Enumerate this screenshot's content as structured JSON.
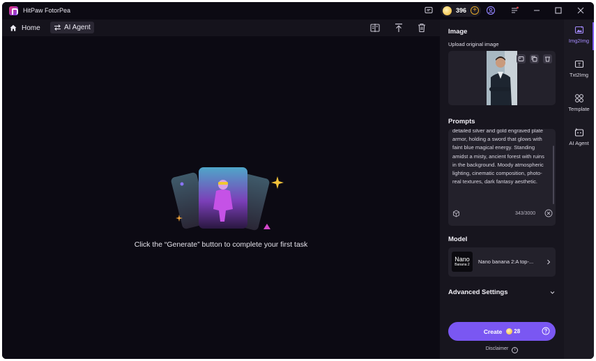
{
  "window": {
    "title": "HitPaw FotorPea",
    "credits": "396"
  },
  "toolbar": {
    "home_label": "Home",
    "agent_label": "AI Agent"
  },
  "canvas": {
    "empty_message": "Click the “Generate” button to complete your first task"
  },
  "panel": {
    "image_heading": "Image",
    "upload_label": "Upload original image",
    "prompts_heading": "Prompts",
    "prompt_text": "detailed silver and gold engraved plate armor, holding a sword that glows with faint blue magical energy. Standing amidst a misty, ancient forest with ruins in the background. Moody atmospheric lighting, cinematic composition, photo-real textures, dark fantasy aesthetic.",
    "char_count": "343/3000",
    "model_heading": "Model",
    "model_thumb_line1": "Nano",
    "model_thumb_line2": "Banana 2",
    "model_name": "Nano banana 2:A top-...",
    "advanced_label": "Advanced Settings",
    "create_label": "Create",
    "create_cost": "28",
    "disclaimer": "Disclaimer"
  },
  "sidebar": {
    "items": [
      {
        "label": "Img2Img",
        "active": true
      },
      {
        "label": "Txt2Img",
        "active": false
      },
      {
        "label": "Template",
        "active": false
      },
      {
        "label": "AI Agent",
        "active": false
      }
    ]
  },
  "colors": {
    "accent": "#7a57f2",
    "background": "#0c0a13",
    "panel": "#17151e",
    "coin": "#f2b328"
  }
}
